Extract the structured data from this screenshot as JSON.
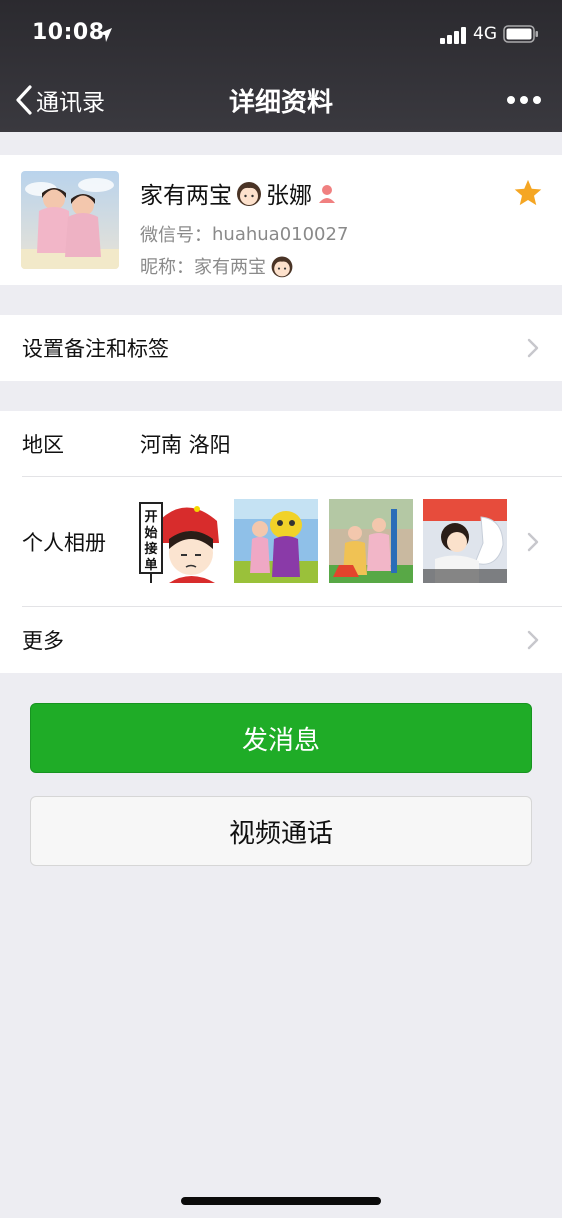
{
  "status_bar": {
    "time": "10:08",
    "network": "4G"
  },
  "nav": {
    "back_label": "通讯录",
    "title": "详细资料"
  },
  "profile": {
    "name": "家有两宝",
    "name_suffix": "张娜",
    "wechat_id_label": "微信号：",
    "wechat_id": "huahua010027",
    "nickname_label": "昵称：",
    "nickname": "家有两宝",
    "starred": true,
    "star_color": "#f5a623"
  },
  "remark_row": {
    "label": "设置备注和标签"
  },
  "region_row": {
    "label": "地区",
    "value": "河南 洛阳"
  },
  "album_row": {
    "label": "个人相册",
    "sticker_text": "开始接单"
  },
  "more_row": {
    "label": "更多"
  },
  "buttons": {
    "message": "发消息",
    "video_call": "视频通话"
  },
  "colors": {
    "primary_green": "#1fac27",
    "header_bg": "#2e2d32",
    "page_bg": "#ededf2"
  }
}
